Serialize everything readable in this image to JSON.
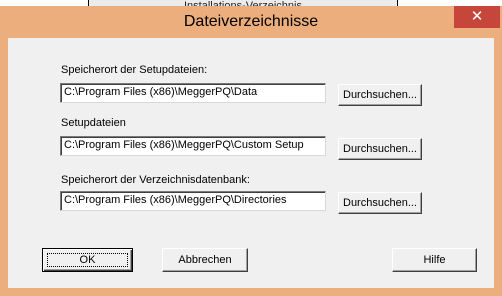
{
  "window": {
    "title": "Dateiverzeichnisse",
    "close_glyph": "✕",
    "close_icon": "close-icon"
  },
  "behind": {
    "partial_text": "Installations-Verzeichnis"
  },
  "fields": [
    {
      "label": "Speicherort der Setupdateien:",
      "value": "C:\\Program Files (x86)\\MeggerPQ\\Data",
      "browse": "Durchsuchen..."
    },
    {
      "label": "Setupdateien",
      "value": "C:\\Program Files (x86)\\MeggerPQ\\Custom Setup",
      "browse": "Durchsuchen..."
    },
    {
      "label": "Speicherort der Verzeichnisdatenbank:",
      "value": "C:\\Program Files (x86)\\MeggerPQ\\Directories",
      "browse": "Durchsuchen..."
    }
  ],
  "buttons": {
    "ok": "OK",
    "cancel": "Abbrechen",
    "help": "Hilfe"
  },
  "colors": {
    "titlebar": "#ecae7d",
    "close": "#c7463b",
    "client": "#f0f0f0"
  }
}
